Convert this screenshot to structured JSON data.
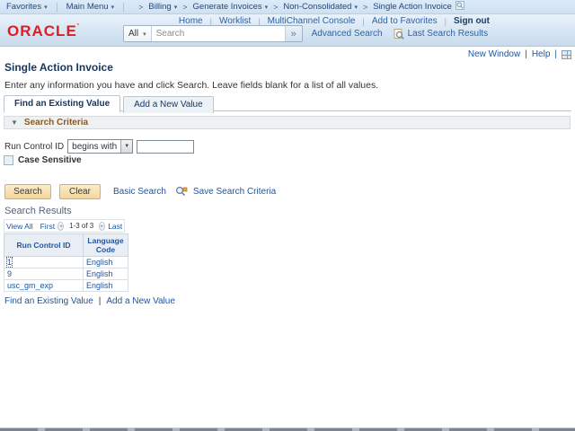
{
  "glyphs": {
    "chevron_down": "▾",
    "breadcrumb_separator": ">",
    "pipe": "|",
    "double_arrow": "»",
    "triangle_down": "▼",
    "select_arrow": "▼",
    "nav_prev": "◄",
    "nav_next": "►"
  },
  "breadcrumb": {
    "items": [
      {
        "label": "Favorites"
      },
      {
        "label": "Main Menu"
      },
      {
        "label": "Billing"
      },
      {
        "label": "Generate Invoices"
      },
      {
        "label": "Non-Consolidated"
      },
      {
        "label": "Single Action Invoice"
      }
    ]
  },
  "header": {
    "logo": "ORACLE",
    "links": [
      "Home",
      "Worklist",
      "MultiChannel Console",
      "Add to Favorites"
    ],
    "sign_out": "Sign out",
    "search_scope": "All",
    "search_placeholder": "Search",
    "advanced_search": "Advanced Search",
    "last_search_results": "Last Search Results"
  },
  "page_links": {
    "new_window": "New Window",
    "help": "Help"
  },
  "page": {
    "title": "Single Action Invoice",
    "instruction": "Enter any information you have and click Search. Leave fields blank for a list of all values."
  },
  "tabs": {
    "active": "Find an Existing Value",
    "inactive": "Add a New Value"
  },
  "criteria": {
    "header": "Search Criteria",
    "field_label": "Run Control ID",
    "operator": "begins with",
    "input_value": "",
    "case_sensitive_label": "Case Sensitive"
  },
  "actions": {
    "search": "Search",
    "clear": "Clear",
    "basic_search": "Basic Search",
    "save_search": "Save Search Criteria"
  },
  "results": {
    "heading": "Search Results",
    "view_all": "View All",
    "first": "First",
    "range": "1-3 of 3",
    "last": "Last",
    "table": {
      "headers": [
        "Run Control ID",
        "Language Code"
      ],
      "rows": [
        [
          "1",
          "English"
        ],
        [
          "9",
          "English"
        ],
        [
          "usc_gm_exp",
          "English"
        ]
      ]
    }
  },
  "footer": {
    "find_existing": "Find an Existing Value",
    "add_new": "Add a New Value"
  }
}
